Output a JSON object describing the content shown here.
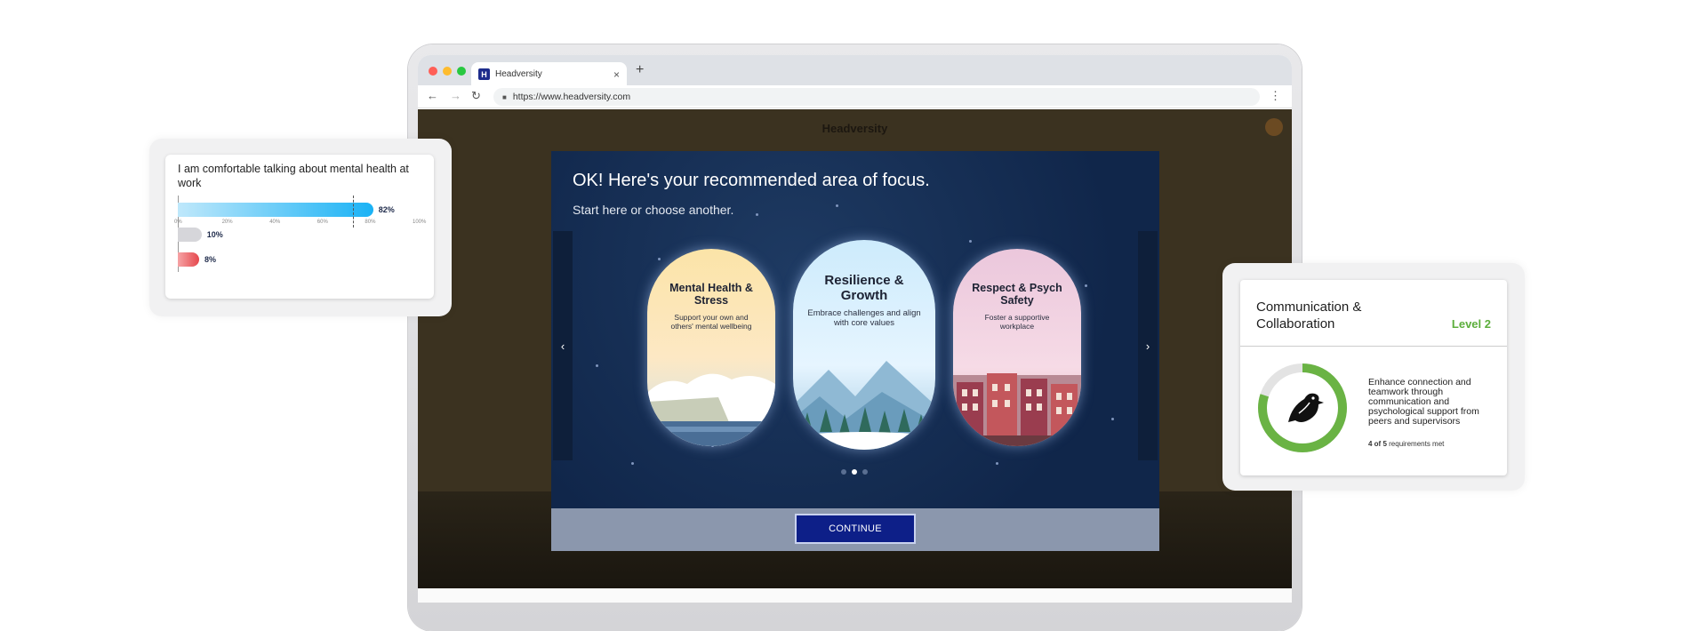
{
  "browser": {
    "tab_title": "Headversity",
    "favicon_letter": "H",
    "url": "https://www.headversity.com",
    "tab_close": "×",
    "new_tab": "+",
    "back": "←",
    "forward": "→",
    "reload": "↻",
    "menu": "⋮",
    "traffic_lights": [
      "#ff5f57",
      "#febc2e",
      "#28c840"
    ]
  },
  "app": {
    "brand": "Headversity"
  },
  "modal": {
    "title": "OK! Here's your recommended area of focus.",
    "subtitle": "Start here or choose another.",
    "prev_arrow": "‹",
    "next_arrow": "›",
    "cards": [
      {
        "title": "Mental Health & Stress",
        "desc": "Support your own and others' mental wellbeing"
      },
      {
        "title": "Resilience & Growth",
        "desc": "Embrace challenges and align with core values"
      },
      {
        "title": "Respect & Psych Safety",
        "desc": "Foster a supportive workplace"
      }
    ],
    "active_page": 1,
    "page_count": 3,
    "continue_label": "CONTINUE"
  },
  "survey": {
    "question": "I am comfortable talking about mental health at work",
    "ticks": [
      "0%",
      "20%",
      "40%",
      "60%",
      "80%",
      "100%"
    ],
    "results": [
      {
        "value": 82,
        "label": "82%",
        "color": "#1ab2f5"
      },
      {
        "value": 10,
        "label": "10%",
        "color": "#d6d6da"
      },
      {
        "value": 8,
        "label": "8%",
        "color": "#e5484d"
      }
    ]
  },
  "competency": {
    "title": "Communication & Collaboration",
    "level": "Level 2",
    "description": "Enhance connection and teamwork through communication and psychological support from peers and supervisors",
    "req_met": 4,
    "req_total": 5,
    "requirements_bold": "4 of 5",
    "requirements_text": " requirements met",
    "progress_color": "#6ab344"
  }
}
